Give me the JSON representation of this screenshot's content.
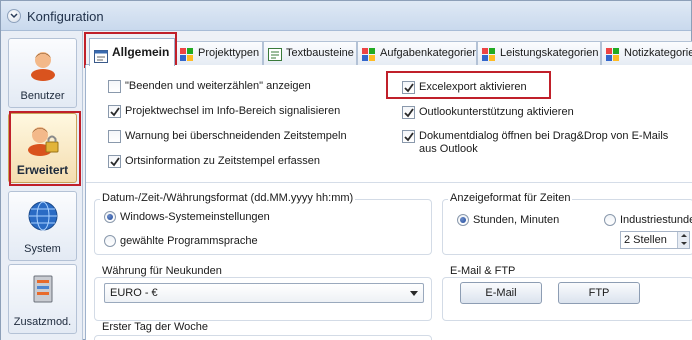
{
  "window": {
    "title": "Konfiguration"
  },
  "nav": {
    "items": [
      {
        "label": "Benutzer",
        "icon": "user-icon"
      },
      {
        "label": "Erweitert",
        "icon": "user-lock-icon",
        "active": true
      },
      {
        "label": "System",
        "icon": "globe-icon"
      },
      {
        "label": "Zusatzmod.",
        "icon": "server-icon"
      }
    ]
  },
  "tabs": [
    {
      "label": "Allgemein",
      "icon": "settings-form-icon",
      "active": true
    },
    {
      "label": "Projekttypen",
      "icon": "project-types-icon"
    },
    {
      "label": "Textbausteine",
      "icon": "text-blocks-icon"
    },
    {
      "label": "Aufgabenkategorien",
      "icon": "categories-icon"
    },
    {
      "label": "Leistungskategorien",
      "icon": "categories-icon"
    },
    {
      "label": "Notizkategorie",
      "icon": "categories-icon"
    }
  ],
  "checkboxes": {
    "left": [
      {
        "label": "\"Beenden und weiterzählen\" anzeigen",
        "checked": false
      },
      {
        "label": "Projektwechsel im Info-Bereich signalisieren",
        "checked": true
      },
      {
        "label": "Warnung bei überschneidenden Zeitstempeln",
        "checked": false
      },
      {
        "label": "Ortsinformation zu Zeitstempel erfassen",
        "checked": true
      }
    ],
    "right": [
      {
        "label": "Excelexport aktivieren",
        "checked": true
      },
      {
        "label": "Outlookunterstützung aktivieren",
        "checked": true
      },
      {
        "label_line1": "Dokumentdialog öffnen bei Drag&Drop von E-Mails",
        "label_line2": "aus Outlook",
        "checked": true
      }
    ]
  },
  "datetime_group": {
    "title": "Datum-/Zeit-/Währungsformat (dd.MM.yyyy hh:mm)",
    "options": [
      {
        "label": "Windows-Systemeinstellungen",
        "selected": true
      },
      {
        "label": "gewählte Programmsprache",
        "selected": false
      }
    ]
  },
  "time_format_group": {
    "title": "Anzeigeformat für Zeiten",
    "options": [
      {
        "label": "Stunden, Minuten",
        "selected": true
      },
      {
        "label": "Industriestunde",
        "selected": false
      }
    ],
    "decimals": "2 Stellen"
  },
  "currency_group": {
    "title": "Währung für Neukunden",
    "value": "EURO - €"
  },
  "email_group": {
    "title": "E-Mail & FTP",
    "email_button": "E-Mail",
    "ftp_button": "FTP"
  },
  "weekstart_group": {
    "title": "Erster Tag der Woche"
  },
  "colors": {
    "highlight": "#c0202a",
    "accent": "#1f4a9e"
  }
}
